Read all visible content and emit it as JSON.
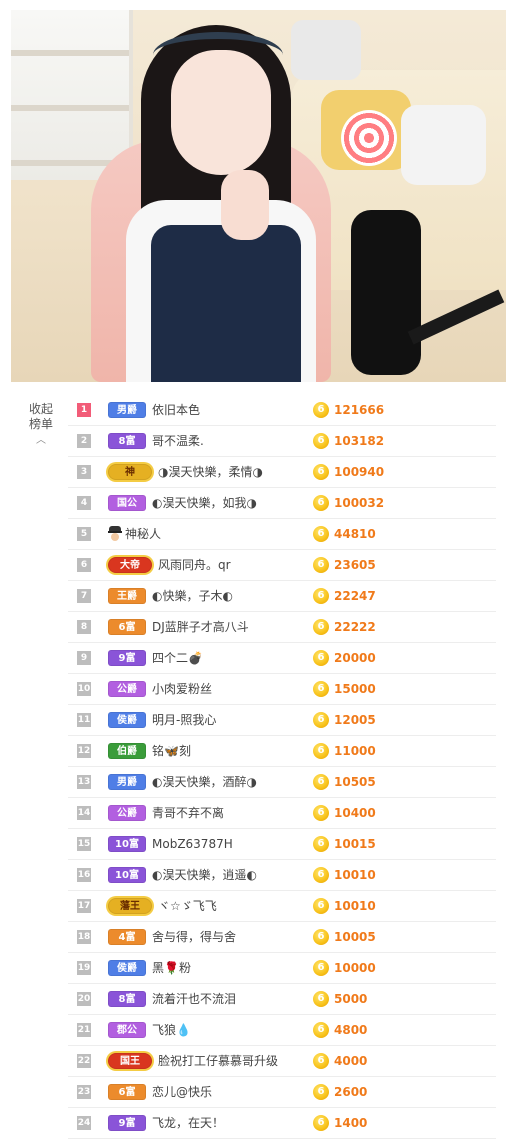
{
  "stream": {
    "label": ""
  },
  "sidebar_toggle": {
    "label_line1": "收起",
    "label_line2": "榜单",
    "icon": "chevron-up-icon"
  },
  "colors": {
    "amount": "#f07a1a",
    "rank_top": "#f25c78",
    "rank_default": "#bdbdbd",
    "coin": "#f8c21a"
  },
  "coin_glyph": "6",
  "ranking": [
    {
      "rank": "1",
      "badge": "男爵",
      "badge_style": "blue",
      "name": "依旧本色",
      "amount": "121666"
    },
    {
      "rank": "2",
      "badge": "8富",
      "badge_style": "purple",
      "name": "哥不温柔.",
      "amount": "103182"
    },
    {
      "rank": "3",
      "badge": "神",
      "badge_style": "gold-wing",
      "name": "◑淏天快樂，柔情◑",
      "amount": "100940"
    },
    {
      "rank": "4",
      "badge": "国公",
      "badge_style": "violet",
      "name": "◐淏天快樂，如我◑",
      "amount": "100032"
    },
    {
      "rank": "5",
      "badge": "",
      "badge_style": "spy",
      "name": "神秘人",
      "amount": "44810"
    },
    {
      "rank": "6",
      "badge": "大帝",
      "badge_style": "red-wing",
      "name": "风雨同舟。qr",
      "amount": "23605"
    },
    {
      "rank": "7",
      "badge": "王爵",
      "badge_style": "orange",
      "name": "◐快樂，子木◐",
      "amount": "22247"
    },
    {
      "rank": "8",
      "badge": "6富",
      "badge_style": "orange",
      "name": "DJ蓝胖子才高八斗",
      "amount": "22222"
    },
    {
      "rank": "9",
      "badge": "9富",
      "badge_style": "purple",
      "name": "四个二💣",
      "amount": "20000"
    },
    {
      "rank": "10",
      "badge": "公爵",
      "badge_style": "violet",
      "name": "小肉爱粉丝",
      "amount": "15000"
    },
    {
      "rank": "11",
      "badge": "侯爵",
      "badge_style": "blue",
      "name": "明月-照我心",
      "amount": "12005"
    },
    {
      "rank": "12",
      "badge": "伯爵",
      "badge_style": "green",
      "name": "铭🦋刻",
      "amount": "11000"
    },
    {
      "rank": "13",
      "badge": "男爵",
      "badge_style": "blue",
      "name": "◐淏天快樂，酒醉◑",
      "amount": "10505"
    },
    {
      "rank": "14",
      "badge": "公爵",
      "badge_style": "violet",
      "name": "青哥不弃不离",
      "amount": "10400"
    },
    {
      "rank": "15",
      "badge": "10富",
      "badge_style": "purple",
      "name": "MobZ63787H",
      "amount": "10015"
    },
    {
      "rank": "16",
      "badge": "10富",
      "badge_style": "purple",
      "name": "◐淏天快樂，逍遥◐",
      "amount": "10010"
    },
    {
      "rank": "17",
      "badge": "藩王",
      "badge_style": "gold-wing",
      "name": "ヾ☆ゞ飞飞",
      "amount": "10010"
    },
    {
      "rank": "18",
      "badge": "4富",
      "badge_style": "orange",
      "name": "舍与得，得与舍",
      "amount": "10005"
    },
    {
      "rank": "19",
      "badge": "侯爵",
      "badge_style": "blue",
      "name": "黑🌹粉",
      "amount": "10000"
    },
    {
      "rank": "20",
      "badge": "8富",
      "badge_style": "purple",
      "name": "流着汗也不流泪",
      "amount": "5000"
    },
    {
      "rank": "21",
      "badge": "郡公",
      "badge_style": "violet",
      "name": "飞狼💧",
      "amount": "4800"
    },
    {
      "rank": "22",
      "badge": "国王",
      "badge_style": "red-wing",
      "name": "脸祝打工仔慕慕哥升级",
      "amount": "4000"
    },
    {
      "rank": "23",
      "badge": "6富",
      "badge_style": "orange",
      "name": "恋儿@快乐",
      "amount": "2600"
    },
    {
      "rank": "24",
      "badge": "9富",
      "badge_style": "purple",
      "name": "飞龙，在天！",
      "amount": "1400"
    }
  ]
}
